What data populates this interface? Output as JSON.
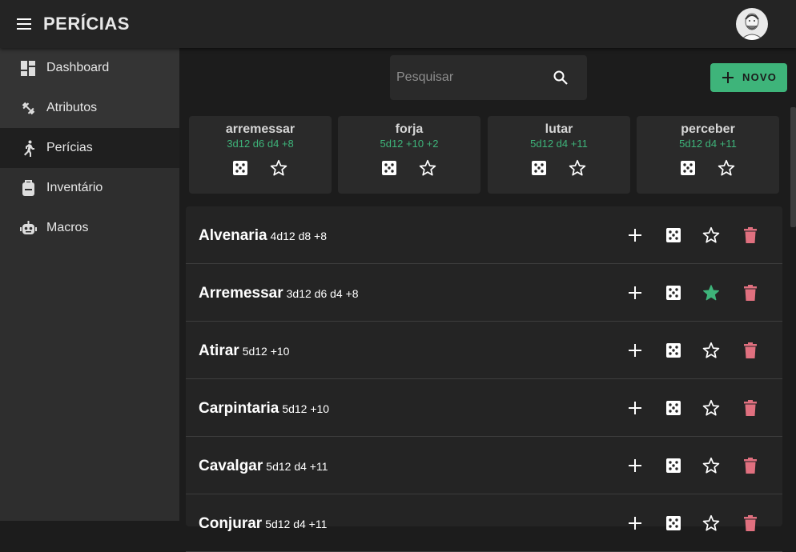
{
  "app": {
    "title": "PERÍCIAS"
  },
  "sidebar": {
    "items": [
      {
        "label": "Dashboard",
        "icon": "dashboard-icon"
      },
      {
        "label": "Atributos",
        "icon": "dumbbell-icon"
      },
      {
        "label": "Perícias",
        "icon": "running-person-icon"
      },
      {
        "label": "Inventário",
        "icon": "backpack-icon"
      },
      {
        "label": "Macros",
        "icon": "robot-icon"
      }
    ]
  },
  "search": {
    "placeholder": "Pesquisar",
    "value": ""
  },
  "toolbar": {
    "new_label": "NOVO"
  },
  "favorites": [
    {
      "name": "arremessar",
      "dice": "3d12 d6 d4 +8"
    },
    {
      "name": "forja",
      "dice": "5d12 +10 +2"
    },
    {
      "name": "lutar",
      "dice": "5d12 d4 +11"
    },
    {
      "name": "perceber",
      "dice": "5d12 d4 +11"
    }
  ],
  "skills": [
    {
      "name": "Alvenaria",
      "dice": "4d12 d8 +8",
      "favorite": false
    },
    {
      "name": "Arremessar",
      "dice": "3d12 d6 d4 +8",
      "favorite": true
    },
    {
      "name": "Atirar",
      "dice": "5d12 +10",
      "favorite": false
    },
    {
      "name": "Carpintaria",
      "dice": "5d12 +10",
      "favorite": false
    },
    {
      "name": "Cavalgar",
      "dice": "5d12 d4 +11",
      "favorite": false
    },
    {
      "name": "Conjurar",
      "dice": "5d12 d4 +11",
      "favorite": false
    }
  ],
  "colors": {
    "accent": "#3eb47a",
    "danger": "#e0707f",
    "background": "#1c1c1c",
    "sidebar": "#2e2e2e",
    "card": "#2a2a2a"
  }
}
